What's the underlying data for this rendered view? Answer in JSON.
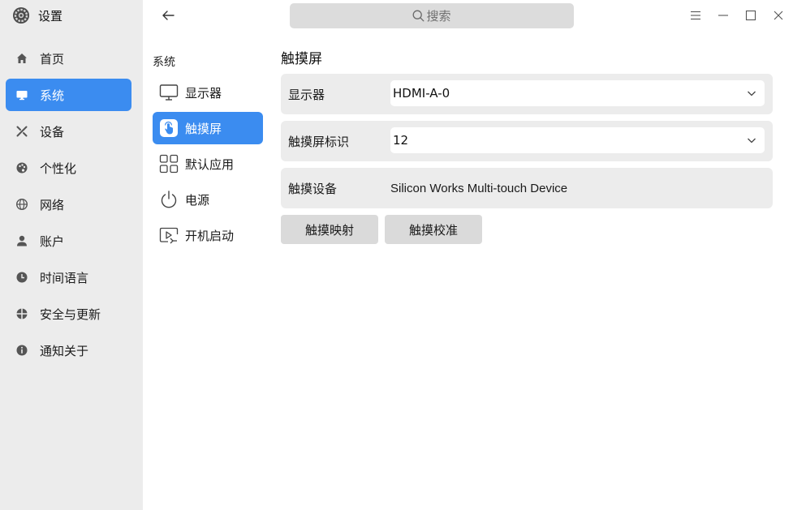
{
  "app": {
    "title": "设置"
  },
  "sidebar": {
    "items": [
      {
        "label": "首页",
        "icon": "home-icon"
      },
      {
        "label": "系统",
        "icon": "monitor-icon",
        "active": true
      },
      {
        "label": "设备",
        "icon": "tools-icon"
      },
      {
        "label": "个性化",
        "icon": "palette-icon"
      },
      {
        "label": "网络",
        "icon": "globe-icon"
      },
      {
        "label": "账户",
        "icon": "user-icon"
      },
      {
        "label": "时间语言",
        "icon": "clock-icon"
      },
      {
        "label": "安全与更新",
        "icon": "shield-icon"
      },
      {
        "label": "通知关于",
        "icon": "info-icon"
      }
    ]
  },
  "subnav": {
    "heading": "系统",
    "items": [
      {
        "label": "显示器",
        "icon": "display-icon"
      },
      {
        "label": "触摸屏",
        "icon": "touch-icon",
        "active": true
      },
      {
        "label": "默认应用",
        "icon": "apps-grid-icon"
      },
      {
        "label": "电源",
        "icon": "power-icon"
      },
      {
        "label": "开机启动",
        "icon": "autostart-icon"
      }
    ]
  },
  "search": {
    "placeholder": "搜索"
  },
  "main": {
    "title": "触摸屏",
    "display_label": "显示器",
    "display_value": "HDMI-A-0",
    "touch_id_label": "触摸屏标识",
    "touch_id_value": "12",
    "device_label": "触摸设备",
    "device_value": "Silicon Works Multi-touch Device",
    "map_button": "触摸映射",
    "calibrate_button": "触摸校准"
  },
  "colors": {
    "accent": "#3b8cf0",
    "sidebar_bg": "#ececec",
    "row_bg": "#ececec"
  }
}
